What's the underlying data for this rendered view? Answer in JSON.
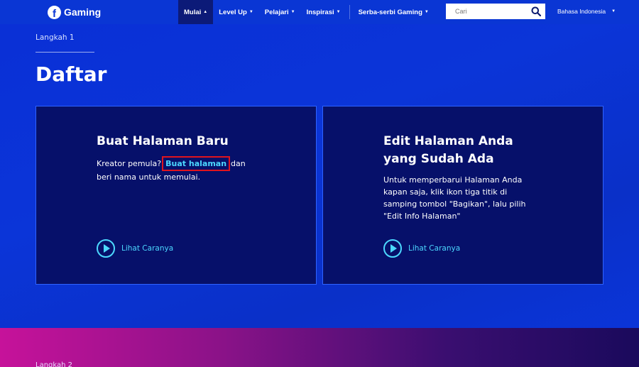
{
  "nav": {
    "logo_text": "Gaming",
    "menu": [
      {
        "label": "Mulai",
        "active": true
      },
      {
        "label": "Level Up",
        "active": false
      },
      {
        "label": "Pelajari",
        "active": false
      },
      {
        "label": "Inspirasi",
        "active": false
      },
      {
        "label": "Serba-serbi Gaming",
        "active": false
      }
    ],
    "search_placeholder": "Cari",
    "language": "Bahasa Indonesia"
  },
  "header": {
    "step": "Langkah 1",
    "title": "Daftar"
  },
  "cards": [
    {
      "title": "Buat Halaman Baru",
      "body_before": "Kreator pemula?",
      "link": "Buat halaman",
      "body_after": "dan",
      "body_line2": "beri nama untuk memulai.",
      "watch": "Lihat Caranya"
    },
    {
      "title_line1": "Edit Halaman Anda",
      "title_line2": "yang Sudah Ada",
      "body_lines": [
        "Untuk memperbarui Halaman Anda",
        "kapan saja, klik ikon tiga titik di",
        "samping tombol \"Bagikan\", lalu pilih",
        "\"Edit Info Halaman\""
      ],
      "watch": "Lihat Caranya"
    }
  ],
  "next_step": "Langkah 2",
  "colors": {
    "accent": "#4cd8ff",
    "card_bg": "#06106a",
    "highlight_box": "#e0141e"
  }
}
